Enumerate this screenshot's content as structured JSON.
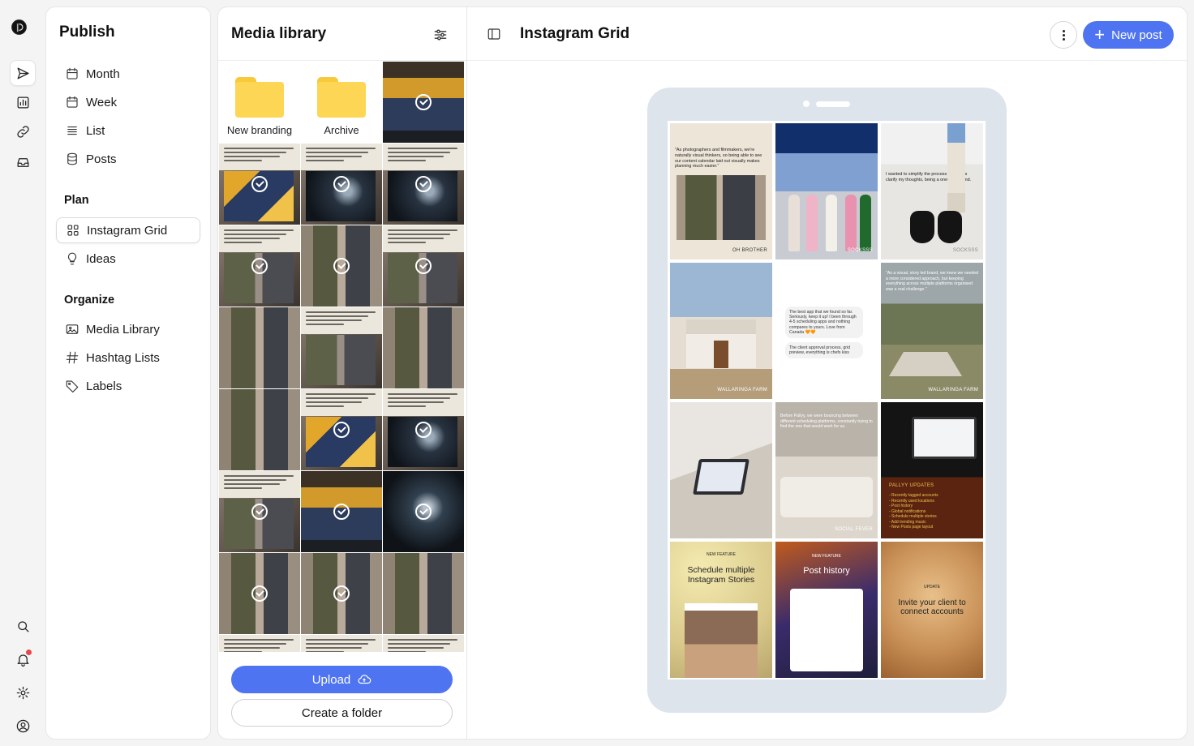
{
  "app": {
    "name": "Publish"
  },
  "rail": {
    "icons": [
      "publish-icon",
      "analytics-icon",
      "link-icon",
      "inbox-icon",
      "search-icon",
      "bell-icon",
      "settings-icon",
      "profile-icon"
    ]
  },
  "nav": {
    "title": "Publish",
    "items": [
      {
        "label": "Month",
        "icon": "calendar-icon"
      },
      {
        "label": "Week",
        "icon": "calendar-icon"
      },
      {
        "label": "List",
        "icon": "list-icon"
      },
      {
        "label": "Posts",
        "icon": "database-icon"
      }
    ],
    "plan_label": "Plan",
    "plan": [
      {
        "label": "Instagram Grid",
        "icon": "grid-icon",
        "active": true
      },
      {
        "label": "Ideas",
        "icon": "lightbulb-icon"
      }
    ],
    "organize_label": "Organize",
    "organize": [
      {
        "label": "Media Library",
        "icon": "image-icon"
      },
      {
        "label": "Hashtag Lists",
        "icon": "hashtag-icon"
      },
      {
        "label": "Labels",
        "icon": "tag-icon"
      }
    ]
  },
  "media": {
    "title": "Media library",
    "folders": [
      {
        "label": "New branding"
      },
      {
        "label": "Archive"
      }
    ],
    "upload_label": "Upload",
    "create_folder_label": "Create a folder"
  },
  "main": {
    "title": "Instagram Grid",
    "new_post_label": "New post"
  },
  "grid_posts": {
    "p1_caption": "\"As photographers and filmmakers, we're naturally visual thinkers, so being able to see our content calendar laid out visually makes planning much easier.\"",
    "p1_tag": "OH BROTHER",
    "p2_tag": "SOCKSSS",
    "p3_caption": "I wanted to simplify the process as well as clarify my thoughts, being a one-man brand.",
    "p3_tag": "SOCKSSS",
    "p4_tag": "WALLARINGA FARM",
    "p5_bubble1": "The best app that we found so far. Seriously, keep it up! I been through 4-5 scheduling apps and nothing compares to yours. Love from Canada 🧡🧡",
    "p5_bubble2": "The client approval process, grid preview, everything is chefs kiss",
    "p6_caption": "\"As a visual, story led brand, we knew we needed a more considered approach, but keeping everything across multiple platforms organised was a real challenge.\"",
    "p6_tag": "WALLARINGA FARM",
    "p8_caption": "Before Pallyy, we were bouncing between different scheduling platforms, constantly trying to find the one that would work for us.",
    "p8_tag": "SOCIAL FEVER",
    "p9_tag": "PALLYY UPDATES",
    "p9_list": "- Recently tagged accounts\n- Recently used locations\n- Post history\n- Global notifications\n- Schedule multiple stories\n- Add trending music\n- New Posts page layout",
    "p10_kicker": "NEW FEATURE",
    "p10_title": "Schedule multiple Instagram Stories",
    "p11_kicker": "NEW FEATURE",
    "p11_title": "Post history",
    "p12_kicker": "UPDATE",
    "p12_title": "Invite your client to connect accounts"
  }
}
